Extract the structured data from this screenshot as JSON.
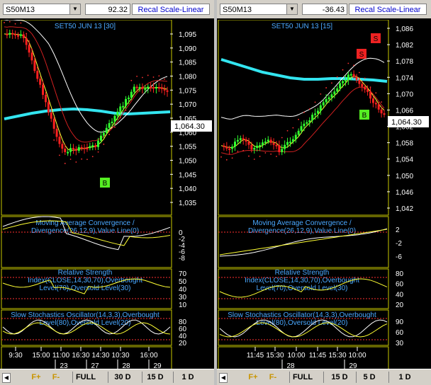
{
  "colors": {
    "ma_slow": "#33e5f0",
    "ma_white": "#ffffff",
    "ma_yellow": "#ffff33",
    "ma_red": "#d02020",
    "up_candle": "#30ff30",
    "down_candle": "#ff2020",
    "sar_dots": "#ff3030",
    "title_blue": "#4aa8ff",
    "green_marker": "#55ee22",
    "red_marker": "#ee2222"
  },
  "panels": [
    {
      "symbol": "S50M13",
      "value": "92.32",
      "recal_label": "Recal Scale-Linear",
      "chart_title": "SET50 JUN 13  [30]",
      "price_label": "1,064.30",
      "price_ticks": [
        "1,095",
        "1,090",
        "1,085",
        "1,080",
        "1,075",
        "1,070",
        "1,065",
        "1,060",
        "1,055",
        "1,050",
        "1,045",
        "1,040",
        "1,035"
      ],
      "markers": [
        {
          "label": "B",
          "type": "buy"
        }
      ],
      "macd_title": "Moving Average Convergence /\nDivergence(26,12,9),Value Line(0)",
      "macd_ticks": [
        "0",
        "-2",
        "-4",
        "-6",
        "-8"
      ],
      "rsi_title": "Relative Strength\nIndex(CLOSE,14,30,70),Overbought\nLevel(70),Oversold Level(30)",
      "rsi_ticks": [
        "70",
        "50",
        "40",
        "30",
        "10"
      ],
      "stoch_title": "Slow Stochastics Oscillator(14,3,3),Overbought\nLevel(80),Oversold Level(20)",
      "stoch_ticks": [
        "80",
        "60",
        "40",
        "20"
      ],
      "time_labels": [
        "9:30",
        "15:00",
        "11:00",
        "16:30",
        "14:30",
        "10:30",
        "16:00"
      ],
      "date_labels": [
        "23",
        "27",
        "28",
        "29"
      ],
      "buttons": [
        "F+",
        "F-",
        "FULL",
        "30 D",
        "15 D",
        "1 D"
      ]
    },
    {
      "symbol": "S50M13",
      "value": "-36.43",
      "recal_label": "Recal Scale-Linear",
      "chart_title": "SET50 JUN 13  [15]",
      "price_label": "1,064.30",
      "price_ticks": [
        "1,086",
        "1,082",
        "1,078",
        "1,074",
        "1,070",
        "1,066",
        "1,062",
        "1,058",
        "1,054",
        "1,050",
        "1,046",
        "1,042"
      ],
      "markers": [
        {
          "label": "S",
          "type": "sell"
        },
        {
          "label": "S",
          "type": "sell"
        },
        {
          "label": "B",
          "type": "buy"
        }
      ],
      "macd_title": "Moving Average Convergence /\nDivergence(26,12,9),Value Line(0)",
      "macd_ticks": [
        "2",
        "-2",
        "-6"
      ],
      "rsi_title": "Relative Strength\nIndex(CLOSE,14,30,70),Overbought\nLevel(70),Oversold Level(30)",
      "rsi_ticks": [
        "80",
        "60",
        "40",
        "20"
      ],
      "stoch_title": "Slow Stochastics Oscillator(14,3,3),Overbought\nLevel(80),Oversold Level(20)",
      "stoch_ticks": [
        "90",
        "60",
        "30"
      ],
      "time_labels": [
        "11:45",
        "15:30",
        "10:00",
        "11:45",
        "15:30",
        "10:00"
      ],
      "date_labels": [
        "28",
        "29"
      ],
      "buttons": [
        "F+",
        "F-",
        "FULL",
        "15 D",
        "5 D",
        "1 D"
      ]
    }
  ]
}
